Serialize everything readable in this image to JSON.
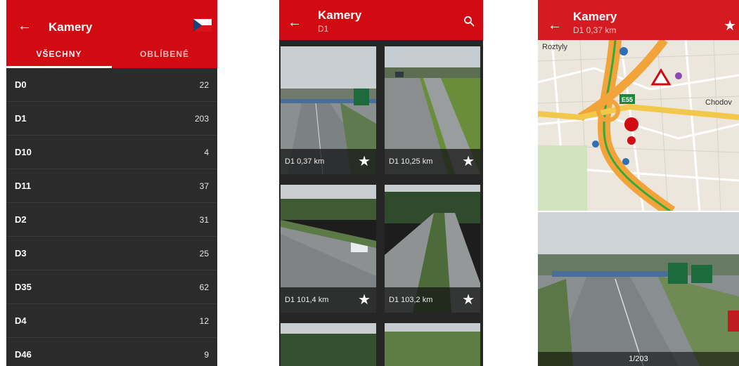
{
  "screen1": {
    "title": "Kamery",
    "tabs": [
      {
        "label": "VŠECHNY",
        "active": true
      },
      {
        "label": "OBLÍBENÉ",
        "active": false
      }
    ],
    "roads": [
      {
        "name": "D0",
        "count": "22"
      },
      {
        "name": "D1",
        "count": "203"
      },
      {
        "name": "D10",
        "count": "4"
      },
      {
        "name": "D11",
        "count": "37"
      },
      {
        "name": "D2",
        "count": "31"
      },
      {
        "name": "D3",
        "count": "25"
      },
      {
        "name": "D35",
        "count": "62"
      },
      {
        "name": "D4",
        "count": "12"
      },
      {
        "name": "D46",
        "count": "9"
      }
    ]
  },
  "screen2": {
    "title": "Kamery",
    "subtitle": "D1",
    "cameras": [
      {
        "label": "D1 0,37 km"
      },
      {
        "label": "D1 10,25 km"
      },
      {
        "label": "D1 101,4 km"
      },
      {
        "label": "D1 103,2 km"
      }
    ]
  },
  "screen3": {
    "title": "Kamery",
    "subtitle": "D1 0,37 km",
    "map": {
      "labels": [
        "Roztyly",
        "Chodov"
      ],
      "road_sign": "E55"
    },
    "pager": "1/203"
  },
  "colors": {
    "accent": "#d20a11",
    "list_bg": "#2b2b2b",
    "grid_bg": "#262626"
  },
  "icons": {
    "back": "arrow-left-icon",
    "search": "search-icon",
    "favorite": "star-icon",
    "flag": "czech-flag-icon"
  }
}
